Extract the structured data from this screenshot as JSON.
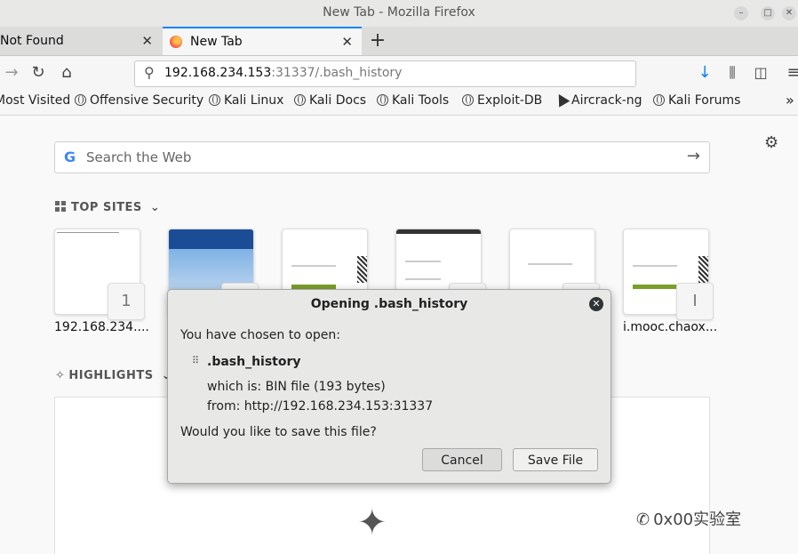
{
  "window": {
    "title": "New Tab - Mozilla Firefox"
  },
  "tabs": [
    {
      "label": "Not Found"
    },
    {
      "label": "New Tab"
    }
  ],
  "urlbar": {
    "host": "192.168.234.153",
    "rest": ":31337/.bash_history"
  },
  "bookmarks": [
    "Most Visited",
    "Offensive Security",
    "Kali Linux",
    "Kali Docs",
    "Kali Tools",
    "Exploit-DB",
    "Aircrack-ng",
    "Kali Forums"
  ],
  "search": {
    "placeholder": "Search the Web"
  },
  "top_sites": {
    "heading": "TOP SITES",
    "tiles": [
      {
        "label": "192.168.234....",
        "badge": "1"
      },
      {
        "label": "",
        "badge": ""
      },
      {
        "label": "",
        "badge": ""
      },
      {
        "label": "",
        "badge": ""
      },
      {
        "label": "",
        "badge": ""
      },
      {
        "label": "i.mooc.chaox...",
        "badge": "I"
      }
    ]
  },
  "highlights": {
    "heading": "HIGHLIGHTS"
  },
  "dialog": {
    "title": "Opening .bash_history",
    "intro": "You have chosen to open:",
    "filename": ".bash_history",
    "which_is": "which is:  BIN file (193 bytes)",
    "from": "from:  http://192.168.234.153:31337",
    "question": "Would you like to save this file?",
    "cancel": "Cancel",
    "save": "Save File"
  },
  "watermark": "0x00实验室",
  "colors": {
    "accent": "#0a84ff",
    "download_icon": "#0a84ff"
  }
}
